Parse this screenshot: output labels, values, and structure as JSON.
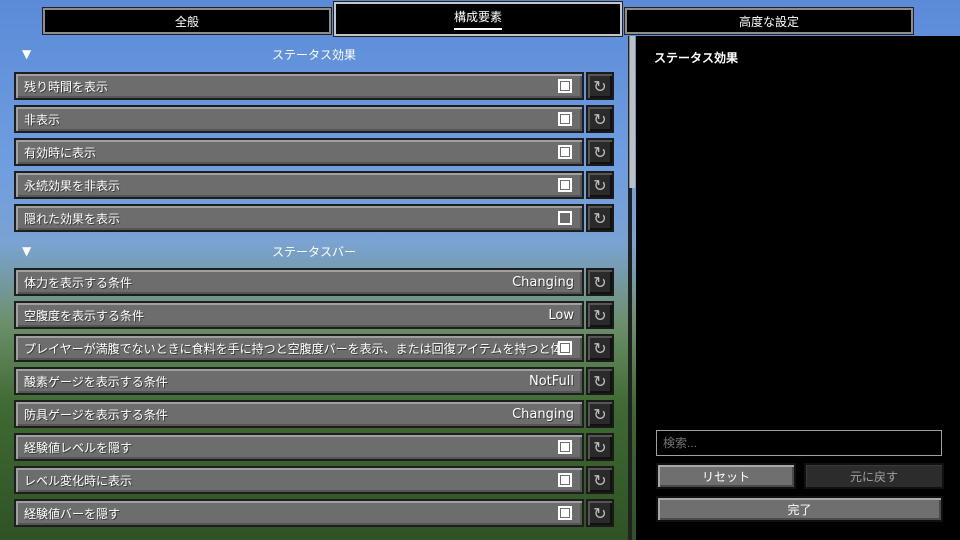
{
  "tabs": [
    {
      "label": "全般"
    },
    {
      "label": "構成要素"
    },
    {
      "label": "高度な設定"
    }
  ],
  "sections": [
    {
      "title": "ステータス効果",
      "rows": [
        {
          "label": "残り時間を表示",
          "type": "check",
          "checked": true
        },
        {
          "label": "非表示",
          "type": "check",
          "checked": true
        },
        {
          "label": "有効時に表示",
          "type": "check",
          "checked": true
        },
        {
          "label": "永続効果を非表示",
          "type": "check",
          "checked": true
        },
        {
          "label": "隠れた効果を表示",
          "type": "check",
          "checked": false
        }
      ]
    },
    {
      "title": "ステータスバー",
      "rows": [
        {
          "label": "体力を表示する条件",
          "type": "value",
          "value": "Changing"
        },
        {
          "label": "空腹度を表示する条件",
          "type": "value",
          "value": "Low"
        },
        {
          "label": "プレイヤーが満腹でないときに食料を手に持つと空腹度バーを表示、または回復アイテムを持つと体...",
          "type": "check",
          "checked": true
        },
        {
          "label": "酸素ゲージを表示する条件",
          "type": "value",
          "value": "NotFull"
        },
        {
          "label": "防具ゲージを表示する条件",
          "type": "value",
          "value": "Changing"
        },
        {
          "label": "経験値レベルを隠す",
          "type": "check",
          "checked": true
        },
        {
          "label": "レベル変化時に表示",
          "type": "check",
          "checked": true
        },
        {
          "label": "経験値バーを隠す",
          "type": "check",
          "checked": true
        }
      ]
    }
  ],
  "side": {
    "title": "ステータス効果",
    "search_placeholder": "検索...",
    "reset_label": "リセット",
    "undo_label": "元に戻す",
    "done_label": "完了"
  },
  "icons": {
    "reset": "reset-arrow-icon",
    "collapse": "collapse-triangle-icon"
  }
}
